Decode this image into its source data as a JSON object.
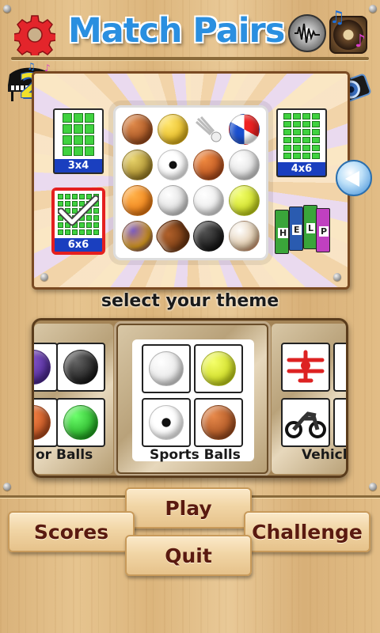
{
  "header": {
    "title": "Match Pairs",
    "level_number": "2"
  },
  "board_sizes": [
    {
      "label": "3x4",
      "selected": false
    },
    {
      "label": "4x6",
      "selected": false
    },
    {
      "label": "6x6",
      "selected": true
    }
  ],
  "help": {
    "letters": [
      "H",
      "E",
      "L",
      "P"
    ]
  },
  "theme_select": {
    "caption": "select your theme",
    "themes": [
      {
        "name": "or Balls"
      },
      {
        "name": "Sports Balls"
      },
      {
        "name": "Vehicl"
      }
    ]
  },
  "menu": {
    "play": "Play",
    "scores": "Scores",
    "challenge": "Challenge",
    "quit": "Quit"
  },
  "colors": {
    "title_blue": "#2a8fe0",
    "grid_green": "#3fd23f",
    "label_blue": "#1a3fbf",
    "selected_red": "#e41f1f",
    "button_text": "#5a1a10"
  }
}
